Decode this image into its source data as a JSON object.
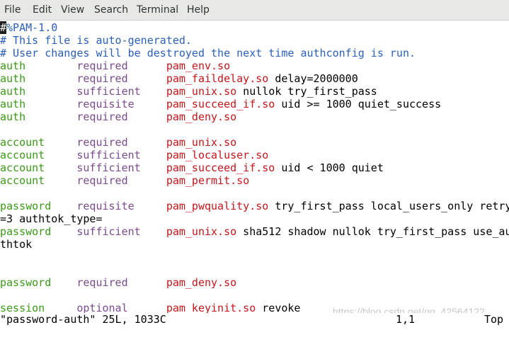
{
  "menubar": {
    "items": [
      "File",
      "Edit",
      "View",
      "Search",
      "Terminal",
      "Help"
    ]
  },
  "editor": {
    "cursor_char": "#",
    "lines": [
      {
        "segments": [
          {
            "t": "%PAM-1.0",
            "c": "comment"
          }
        ]
      },
      {
        "segments": [
          {
            "t": "# This file is auto-generated.",
            "c": "comment"
          }
        ]
      },
      {
        "segments": [
          {
            "t": "# User changes will be destroyed the next time authconfig is run.",
            "c": "comment"
          }
        ]
      },
      {
        "segments": [
          {
            "t": "auth        ",
            "c": "type"
          },
          {
            "t": "required      ",
            "c": "control"
          },
          {
            "t": "pam_env.so",
            "c": "module"
          }
        ]
      },
      {
        "segments": [
          {
            "t": "auth        ",
            "c": "type"
          },
          {
            "t": "required      ",
            "c": "control"
          },
          {
            "t": "pam_faildelay.so",
            "c": "module"
          },
          {
            "t": " delay=2000000",
            "c": "args"
          }
        ]
      },
      {
        "segments": [
          {
            "t": "auth        ",
            "c": "type"
          },
          {
            "t": "sufficient    ",
            "c": "control"
          },
          {
            "t": "pam_unix.so",
            "c": "module"
          },
          {
            "t": " nullok try_first_pass",
            "c": "args"
          }
        ]
      },
      {
        "segments": [
          {
            "t": "auth        ",
            "c": "type"
          },
          {
            "t": "requisite     ",
            "c": "control"
          },
          {
            "t": "pam_succeed_if.so",
            "c": "module"
          },
          {
            "t": " uid >= 1000 quiet_success",
            "c": "args"
          }
        ]
      },
      {
        "segments": [
          {
            "t": "auth        ",
            "c": "type"
          },
          {
            "t": "required      ",
            "c": "control"
          },
          {
            "t": "pam_deny.so",
            "c": "module"
          }
        ]
      },
      {
        "segments": []
      },
      {
        "segments": [
          {
            "t": "account     ",
            "c": "type"
          },
          {
            "t": "required      ",
            "c": "control"
          },
          {
            "t": "pam_unix.so",
            "c": "module"
          }
        ]
      },
      {
        "segments": [
          {
            "t": "account     ",
            "c": "type"
          },
          {
            "t": "sufficient    ",
            "c": "control"
          },
          {
            "t": "pam_localuser.so",
            "c": "module"
          }
        ]
      },
      {
        "segments": [
          {
            "t": "account     ",
            "c": "type"
          },
          {
            "t": "sufficient    ",
            "c": "control"
          },
          {
            "t": "pam_succeed_if.so",
            "c": "module"
          },
          {
            "t": " uid < 1000 quiet",
            "c": "args"
          }
        ]
      },
      {
        "segments": [
          {
            "t": "account     ",
            "c": "type"
          },
          {
            "t": "required      ",
            "c": "control"
          },
          {
            "t": "pam_permit.so",
            "c": "module"
          }
        ]
      },
      {
        "segments": []
      },
      {
        "segments": [
          {
            "t": "password    ",
            "c": "type"
          },
          {
            "t": "requisite     ",
            "c": "control"
          },
          {
            "t": "pam_pwquality.so",
            "c": "module"
          },
          {
            "t": " try_first_pass local_users_only retry",
            "c": "args"
          }
        ]
      },
      {
        "segments": [
          {
            "t": "=3 authtok_type=",
            "c": "args"
          }
        ]
      },
      {
        "segments": [
          {
            "t": "password    ",
            "c": "type"
          },
          {
            "t": "sufficient    ",
            "c": "control"
          },
          {
            "t": "pam_unix.so",
            "c": "module"
          },
          {
            "t": " sha512 shadow nullok try_first_pass use_au",
            "c": "args"
          }
        ]
      },
      {
        "segments": [
          {
            "t": "thtok",
            "c": "args"
          }
        ]
      },
      {
        "segments": []
      },
      {
        "segments": []
      },
      {
        "segments": [
          {
            "t": "password    ",
            "c": "type"
          },
          {
            "t": "required      ",
            "c": "control"
          },
          {
            "t": "pam_deny.so",
            "c": "module"
          }
        ]
      },
      {
        "segments": []
      },
      {
        "segments": [
          {
            "t": "session     ",
            "c": "type"
          },
          {
            "t": "optional      ",
            "c": "control"
          },
          {
            "t": "pam_keyinit.so",
            "c": "module"
          },
          {
            "t": " revoke",
            "c": "args"
          }
        ]
      }
    ]
  },
  "statusline": {
    "file": "\"password-auth\" 25L, 1033C",
    "position": "1,1",
    "scroll": "Top"
  },
  "watermark": {
    "text": "https://blog.csdn.net/qq_42564122"
  },
  "colors": {
    "comment": "#2b60b8",
    "type": "#3a9a16",
    "control": "#7a4b8e",
    "module": "#c4161b",
    "args": "#000000",
    "menubar_bg": "#e8e8e7"
  }
}
